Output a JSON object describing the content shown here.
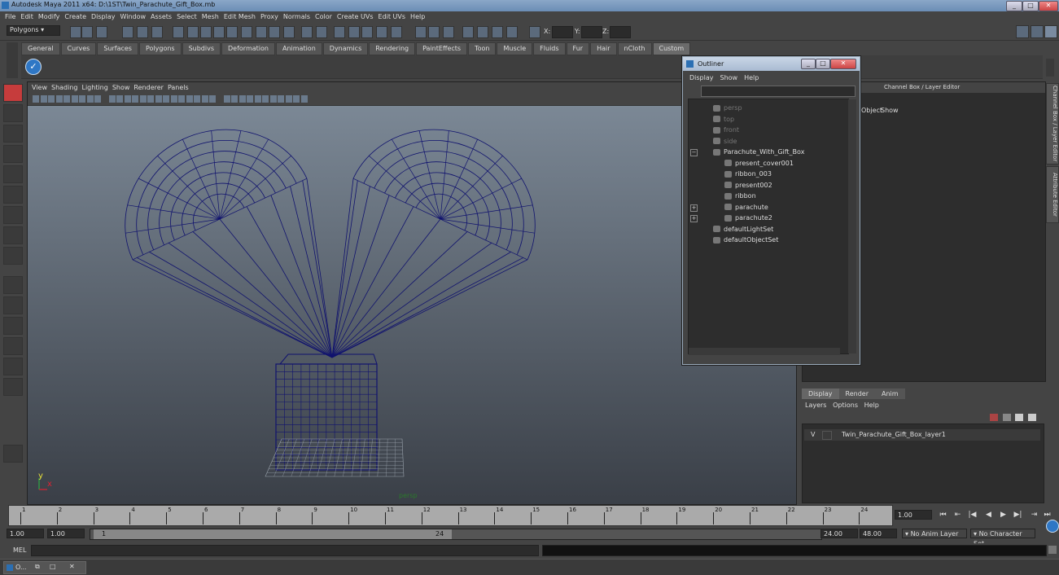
{
  "window": {
    "title": "Autodesk Maya 2011 x64: D:\\1ST\\Twin_Parachute_Gift_Box.mb"
  },
  "menubar": [
    "File",
    "Edit",
    "Modify",
    "Create",
    "Display",
    "Window",
    "Assets",
    "Select",
    "Mesh",
    "Edit Mesh",
    "Proxy",
    "Normals",
    "Color",
    "Create UVs",
    "Edit UVs",
    "Help"
  ],
  "statusline": {
    "mode": "Polygons",
    "x_label": "X:",
    "y_label": "Y:",
    "z_label": "Z:"
  },
  "shelf": {
    "tabs": [
      "General",
      "Curves",
      "Surfaces",
      "Polygons",
      "Subdivs",
      "Deformation",
      "Animation",
      "Dynamics",
      "Rendering",
      "PaintEffects",
      "Toon",
      "Muscle",
      "Fluids",
      "Fur",
      "Hair",
      "nCloth",
      "Custom"
    ],
    "active": "Custom"
  },
  "viewport": {
    "menu": [
      "View",
      "Shading",
      "Lighting",
      "Show",
      "Renderer",
      "Panels"
    ],
    "camera_label": "persp",
    "axis_y": "y",
    "axis_x": "x",
    "wire_color": "#10126e"
  },
  "outliner": {
    "title": "Outliner",
    "menu": [
      "Display",
      "Show",
      "Help"
    ],
    "items": [
      {
        "label": "persp",
        "dim": true
      },
      {
        "label": "top",
        "dim": true
      },
      {
        "label": "front",
        "dim": true
      },
      {
        "label": "side",
        "dim": true
      },
      {
        "label": "Parachute_With_Gift_Box",
        "dim": false
      },
      {
        "label": "present_cover001",
        "dim": false
      },
      {
        "label": "ribbon_003",
        "dim": false
      },
      {
        "label": "present002",
        "dim": false
      },
      {
        "label": "ribbon",
        "dim": false
      },
      {
        "label": "parachute",
        "dim": false
      },
      {
        "label": "parachute2",
        "dim": false
      },
      {
        "label": "defaultLightSet",
        "dim": false
      },
      {
        "label": "defaultObjectSet",
        "dim": false
      }
    ]
  },
  "channel_box": {
    "title": "Channel Box / Layer Editor",
    "menu": [
      "Object",
      "Show"
    ]
  },
  "side_tabs": [
    "Channel Box / Layer Editor",
    "Attribute Editor"
  ],
  "layer_editor": {
    "tabs": [
      "Display",
      "Render",
      "Anim"
    ],
    "active": "Display",
    "menu": [
      "Layers",
      "Options",
      "Help"
    ],
    "layer_visibility": "V",
    "layer_name": "Twin_Parachute_Gift_Box_layer1"
  },
  "timeline": {
    "ticks": [
      "1",
      "2",
      "3",
      "4",
      "5",
      "6",
      "7",
      "8",
      "9",
      "10",
      "11",
      "12",
      "13",
      "14",
      "15",
      "16",
      "17",
      "18",
      "19",
      "20",
      "21",
      "22",
      "23",
      "24"
    ],
    "current_frame": "1.00"
  },
  "range": {
    "start": "1.00",
    "start_inner": "1.00",
    "range_start_label": "1",
    "range_end_label": "24",
    "end_inner": "24.00",
    "end": "48.00",
    "anim_layer": "No Anim Layer",
    "char_set": "No Character Set"
  },
  "mel": {
    "label": "MEL"
  },
  "taskbar": {
    "item": "O..."
  }
}
